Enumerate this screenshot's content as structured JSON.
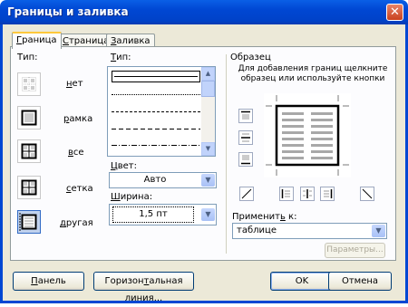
{
  "window": {
    "title": "Границы и заливка"
  },
  "tabs": [
    {
      "label_u": "Г",
      "label_rest": "раница"
    },
    {
      "label_u": "С",
      "label_rest": "траница"
    },
    {
      "label_u": "З",
      "label_rest": "аливка"
    }
  ],
  "setting": {
    "label": "Тип:",
    "items": [
      {
        "label": "нет",
        "label_u": "н",
        "label_rest": "ет"
      },
      {
        "label": "рамка",
        "label_u": "р",
        "label_rest": "амка"
      },
      {
        "label": "все",
        "label_u": "в",
        "label_rest": "се"
      },
      {
        "label": "сетка",
        "label_u": "с",
        "label_rest": "етка"
      },
      {
        "label": "другая",
        "label_u": "д",
        "label_rest": "ругая"
      }
    ],
    "selected": "другая"
  },
  "style": {
    "label_u": "Т",
    "label_rest": "ип:"
  },
  "color": {
    "label_u": "Ц",
    "label_rest": "вет:",
    "value": "Авто"
  },
  "width": {
    "label_u": "Ш",
    "label_rest": "ирина:",
    "value": "1,5 пт"
  },
  "preview": {
    "label": "Образец",
    "hint": "Для добавления границ щелкните образец или используйте кнопки"
  },
  "apply_to": {
    "label_start": "Применит",
    "label_u": "ь",
    "label_rest": " к:",
    "value": "таблице"
  },
  "buttons": {
    "options": "Параметры...",
    "panel_u": "П",
    "panel_rest": "анель",
    "hline_start": "Горизон",
    "hline_u": "т",
    "hline_rest": "альная линия...",
    "ok": "OK",
    "cancel": "Отмена"
  },
  "icons": {
    "close": "close-icon"
  }
}
